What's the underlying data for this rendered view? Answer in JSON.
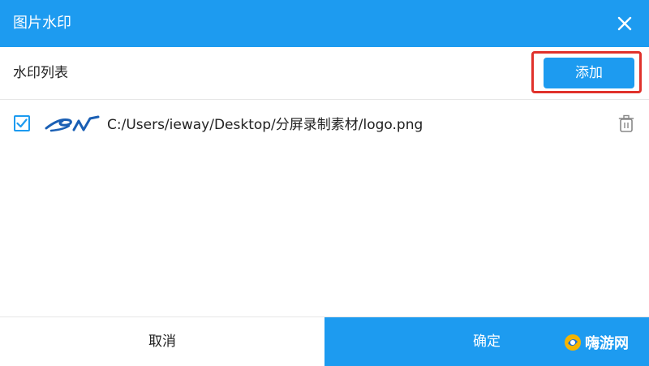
{
  "titlebar": {
    "title": "图片水印",
    "close_icon": "close-icon"
  },
  "list_header": {
    "label": "水印列表",
    "add_label": "添加"
  },
  "watermarks": [
    {
      "checked": true,
      "thumbnail_icon": "logo-thumbnail",
      "path": "C:/Users/ieway/Desktop/分屏录制素材/logo.png",
      "delete_icon": "trash-icon"
    }
  ],
  "footer": {
    "cancel_label": "取消",
    "confirm_label": "确定"
  },
  "site_watermark": {
    "text": "嗨游网"
  },
  "colors": {
    "accent": "#1d9bf0",
    "highlight": "#e0312b",
    "text": "#222222",
    "divider": "#e6e6e6"
  }
}
